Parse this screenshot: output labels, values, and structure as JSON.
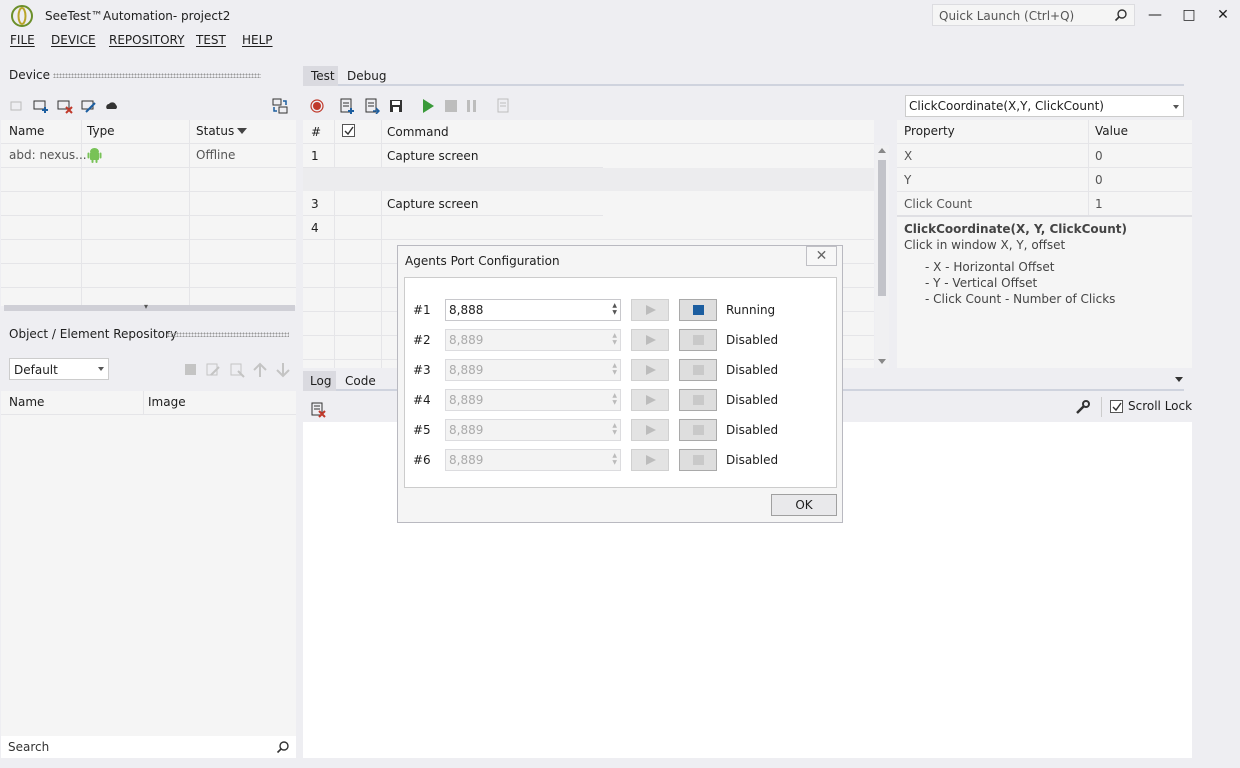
{
  "app": {
    "title": "SeeTest™Automation- project2"
  },
  "quick_launch": {
    "placeholder": "Quick Launch (Ctrl+Q)"
  },
  "window_buttons": {
    "minimize": "—",
    "maximize": "□",
    "close": "✕"
  },
  "menu": [
    "FILE",
    "DEVICE",
    "REPOSITORY",
    "TEST",
    "HELP"
  ],
  "device_panel": {
    "title": "Device",
    "columns": [
      "Name",
      "Type",
      "Status"
    ],
    "rows": [
      {
        "name": "abd: nexus...",
        "type_icon": "android-icon",
        "status": "Offline"
      }
    ]
  },
  "repo_panel": {
    "title": "Object / Element Repository",
    "dropdown": "Default",
    "columns": [
      "Name",
      "Image"
    ],
    "search_placeholder": "Search"
  },
  "test_panel": {
    "tabs": [
      "Test",
      "Debug"
    ],
    "columns": [
      "#",
      "Command"
    ],
    "rows": [
      {
        "num": "1",
        "command": "Capture screen"
      },
      {
        "num": "",
        "command": ""
      },
      {
        "num": "3",
        "command": "Capture screen"
      },
      {
        "num": "4",
        "command": ""
      }
    ]
  },
  "property_panel": {
    "command_select": "ClickCoordinate(X,Y, ClickCount)",
    "columns": [
      "Property",
      "Value"
    ],
    "rows": [
      {
        "name": "X",
        "value": "0"
      },
      {
        "name": "Y",
        "value": "0"
      },
      {
        "name": "Click Count",
        "value": "1"
      }
    ],
    "help_title": "ClickCoordinate(X, Y, ClickCount)",
    "help_desc": "Click in window X, Y, offset",
    "help_items": [
      "- X - Horizontal Offset",
      "- Y - Vertical Offset",
      "- Click Count - Number of Clicks"
    ]
  },
  "log_panel": {
    "tabs": [
      "Log",
      "Code"
    ],
    "scroll_lock": "Scroll Lock"
  },
  "dialog": {
    "title": "Agents Port Configuration",
    "ok": "OK",
    "agents": [
      {
        "label": "#1",
        "port": "8,888",
        "status": "Running"
      },
      {
        "label": "#2",
        "port": "8,889",
        "status": "Disabled"
      },
      {
        "label": "#3",
        "port": "8,889",
        "status": "Disabled"
      },
      {
        "label": "#4",
        "port": "8,889",
        "status": "Disabled"
      },
      {
        "label": "#5",
        "port": "8,889",
        "status": "Disabled"
      },
      {
        "label": "#6",
        "port": "8,889",
        "status": "Disabled"
      }
    ]
  },
  "colors": {
    "accent": "#1c5ea0",
    "record": "#c0392b",
    "run": "#3a9a3a",
    "android": "#78c257"
  }
}
